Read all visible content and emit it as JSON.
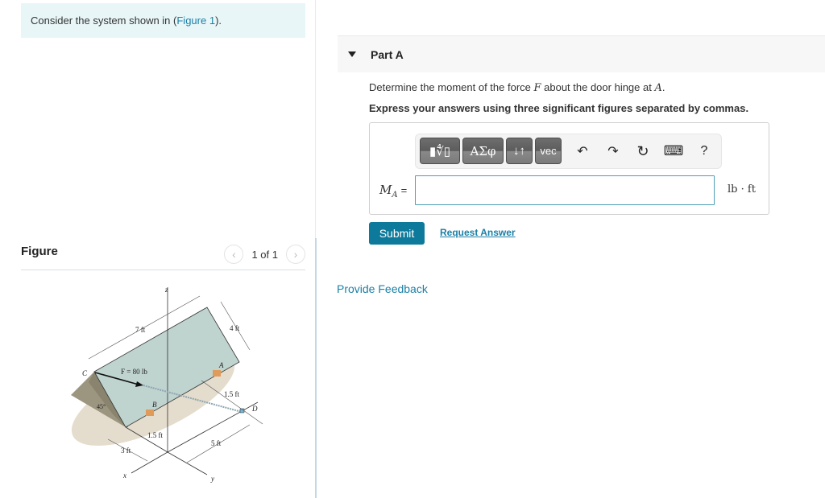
{
  "intro": {
    "prefix": "Consider the system shown in (",
    "link": "Figure 1",
    "suffix": ")."
  },
  "figure": {
    "title": "Figure",
    "pager": {
      "prev_icon": "chevron-left-icon",
      "label": "1 of 1",
      "next_icon": "chevron-right-icon"
    },
    "labels": {
      "z": "z",
      "x": "x",
      "y": "y",
      "C": "C",
      "A": "A",
      "B": "B",
      "D": "D",
      "force": "F = 80 lb",
      "dim_7": "7 ft",
      "dim_4": "4 ft",
      "dim_15a": "1.5 ft",
      "dim_15b": "1.5 ft",
      "dim_3": "3 ft",
      "dim_5": "5 ft",
      "angle": "45°"
    }
  },
  "part": {
    "title": "Part A",
    "question_prefix": "Determine the moment of the force ",
    "question_var": "F",
    "question_mid": " about the door hinge at ",
    "question_point": "A",
    "question_suffix": ".",
    "instruction": "Express your answers using three significant figures separated by commas.",
    "toolbar": {
      "buttons": [
        {
          "name": "templates-button",
          "label": "▮∜▯"
        },
        {
          "name": "greek-symbols-button",
          "label": "ΑΣφ"
        },
        {
          "name": "arrows-button",
          "label": "↓↑"
        },
        {
          "name": "vector-button",
          "label": "vec"
        }
      ],
      "icons": [
        {
          "name": "undo-icon",
          "glyph": "↶"
        },
        {
          "name": "redo-icon",
          "glyph": "↷"
        },
        {
          "name": "reset-icon",
          "glyph": "↻"
        },
        {
          "name": "keyboard-icon",
          "glyph": "⌨"
        },
        {
          "name": "help-icon",
          "glyph": "?"
        }
      ]
    },
    "answer": {
      "label_var": "M",
      "label_sub": "A",
      "label_eq": "=",
      "value": "",
      "unit": "lb · ft"
    },
    "submit_label": "Submit",
    "request_answer_label": "Request Answer"
  },
  "feedback_label": "Provide Feedback"
}
